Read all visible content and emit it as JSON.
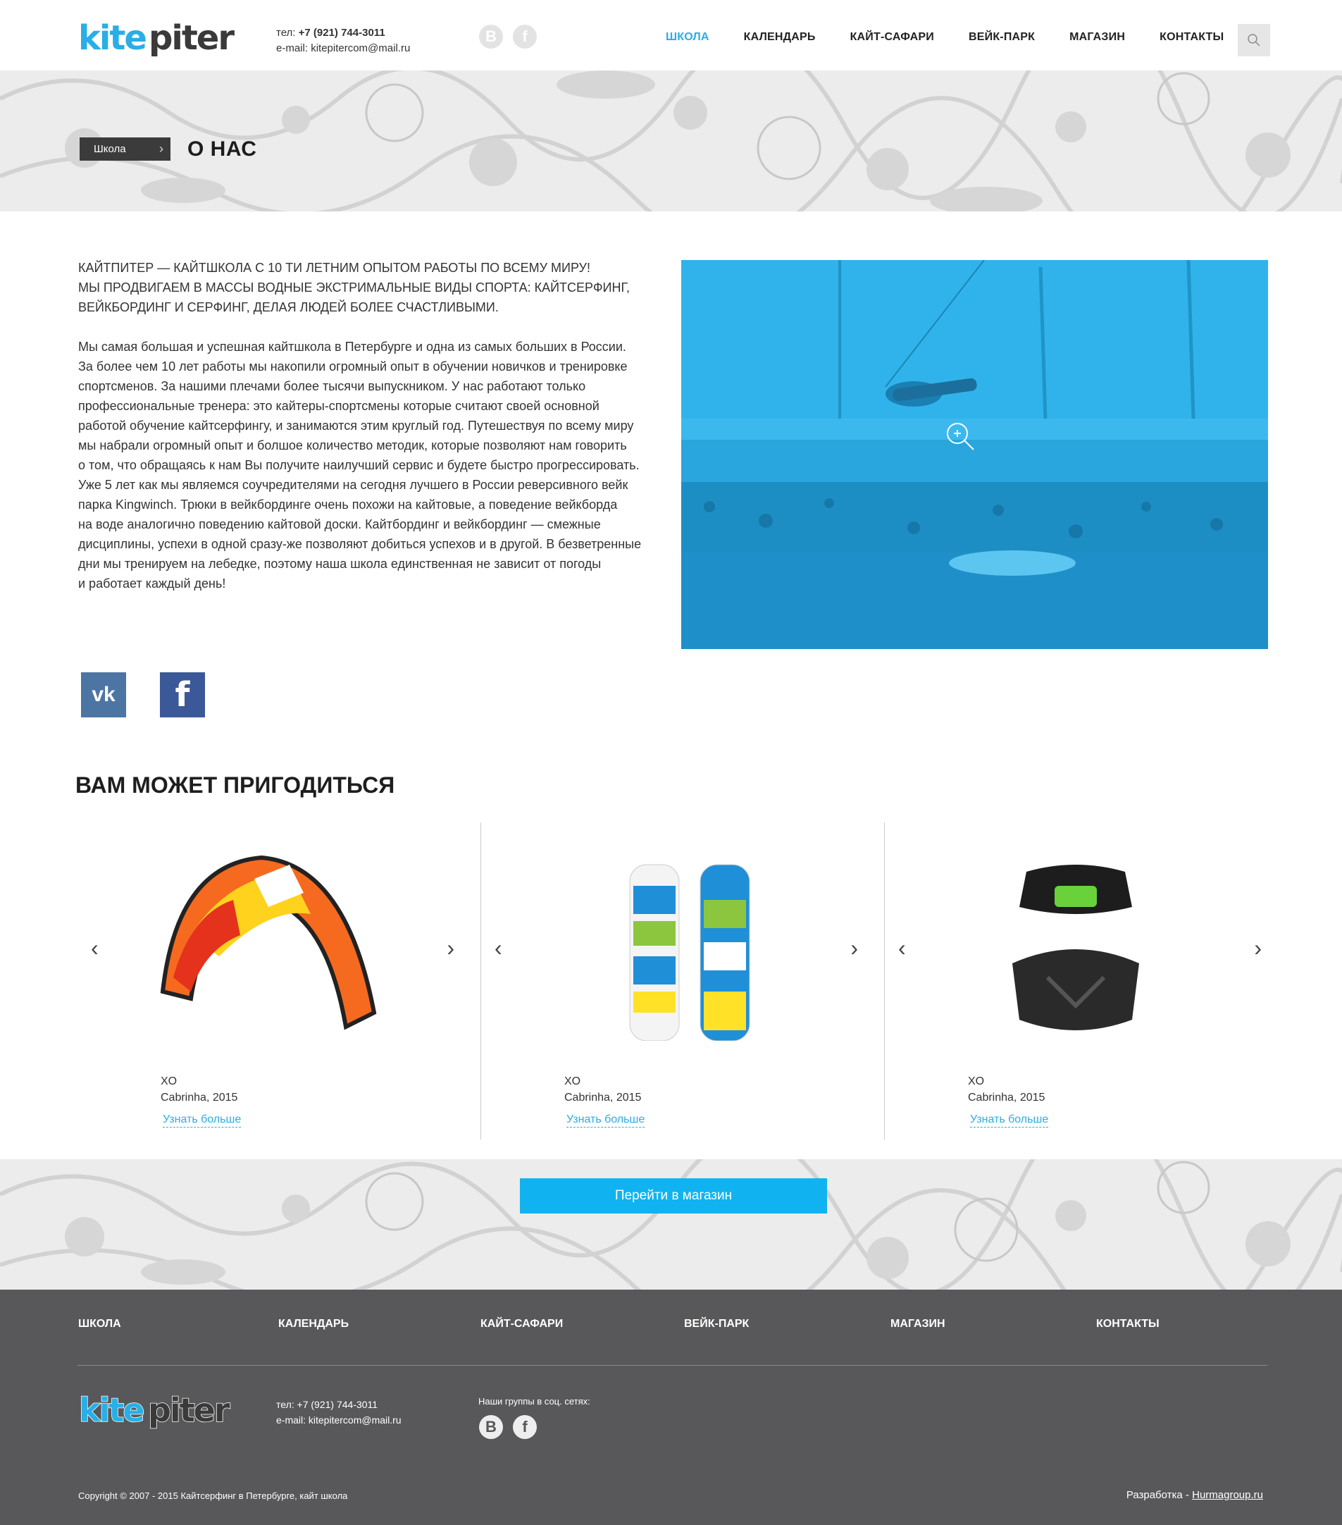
{
  "header": {
    "logo_text": "kitepiter",
    "phone_label": "тел:",
    "phone": "+7 (921) 744-3011",
    "email_label": "e-mail:",
    "email": "kitepitercom@mail.ru",
    "social": [
      "B",
      "f"
    ],
    "nav": [
      "ШКОЛА",
      "КАЛЕНДАРЬ",
      "КАЙТ-САФАРИ",
      "ВЕЙК-ПАРК",
      "МАГАЗИН",
      "КОНТАКТЫ"
    ],
    "active_nav": "ШКОЛА"
  },
  "banner": {
    "breadcrumb": "Школа",
    "title": "О НАС"
  },
  "intro_lines": [
    "КАЙТПИТЕР — КАЙТШКОЛА С 10 ТИ ЛЕТНИМ ОПЫТОМ РАБОТЫ ПО ВСЕМУ МИРУ!",
    "МЫ ПРОДВИГАЕМ В МАССЫ ВОДНЫЕ ЭКСТРИМАЛЬНЫЕ ВИДЫ СПОРТА: КАЙТСЕРФИНГ,",
    "ВЕЙКБОРДИНГ И СЕРФИНГ, ДЕЛАЯ ЛЮДЕЙ БОЛЕЕ СЧАСТЛИВЫМИ."
  ],
  "body_lines": [
    "Мы самая большая и успешная кайтшкола в Петербурге и одна из самых больших в России.",
    "За более чем 10 лет работы мы накопили огромный опыт в обучении новичков и тренировке",
    "спортсменов. За нашими плечами более тысячи выпускником. У нас работают только",
    "профессиональные тренера: это кайтеры-спортсмены которые считают своей основной",
    "работой обучение кайтсерфингу, и занимаются этим круглый год. Путешествуя по всему миру",
    "мы набрали огромный опыт и болшое количество методик, которые позволяют нам говорить",
    "о том, что обращаясь к нам Вы получите наилучший сервис и будете быстро прогрессировать.",
    "Уже 5 лет как мы являемся соучредителями на сегодня лучшего в России реверсивного вейк",
    "парка Kingwinch. Трюки в вейкбординге очень похожи на кайтовые, а поведение вейкборда",
    "на воде аналогично поведению кайтовой доски. Кайтбординг и вейкбординг — смежные",
    "дисциплины, успехи в одной сразу-же позволяют добиться успехов и в другой. В безветренные",
    "дни мы тренируем на лебедке, поэтому наша школа единственная не зависит от погоды",
    "и работает каждый день!"
  ],
  "share": {
    "vk": "vk",
    "fb": "f"
  },
  "section_title": "ВАМ МОЖЕТ ПРИГОДИТЬСЯ",
  "products": [
    {
      "name": "XO",
      "brand": "Cabrinha, 2015",
      "more": "Узнать больше",
      "icon": "kite-image"
    },
    {
      "name": "XO",
      "brand": "Cabrinha, 2015",
      "more": "Узнать больше",
      "icon": "wakeboard-image"
    },
    {
      "name": "XO",
      "brand": "Cabrinha, 2015",
      "more": "Узнать больше",
      "icon": "harness-image"
    }
  ],
  "shop_button": "Перейти в магазин",
  "footer": {
    "nav": [
      "ШКОЛА",
      "КАЛЕНДАРЬ",
      "КАЙТ-САФАРИ",
      "ВЕЙК-ПАРК",
      "МАГАЗИН",
      "КОНТАКТЫ"
    ],
    "phone_line": "тел: +7 (921) 744-3011",
    "email_line": "e-mail: kitepitercom@mail.ru",
    "groups_label": "Наши группы в соц. сетях:",
    "social": [
      "B",
      "f"
    ],
    "copyright": "Copyright © 2007 - 2015 Кайтсерфинг в Петербурге, кайт школа",
    "dev_label": "Разработка -",
    "dev_link": "Hurmagroup.ru"
  },
  "colors": {
    "accent": "#29aee6",
    "button": "#10b3f0",
    "footer": "#58585a",
    "photo_tint": "#27a9e1"
  }
}
